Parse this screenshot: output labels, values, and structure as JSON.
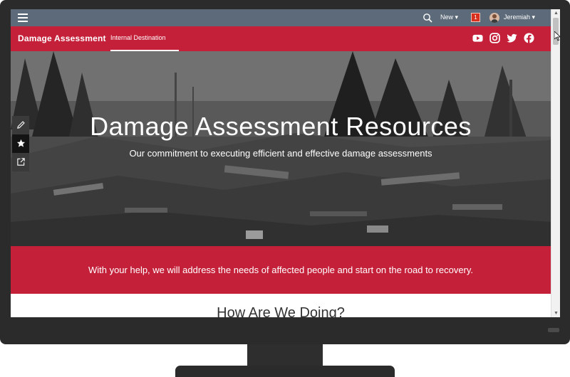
{
  "topbar": {
    "new_label": "New ▾",
    "notification_count": "1",
    "user_label": "Jeremiah ▾"
  },
  "nav": {
    "site_title": "Damage Assessment",
    "link_label": "Internal Destination",
    "social_icons": [
      "youtube-icon",
      "instagram-icon",
      "twitter-icon",
      "facebook-icon"
    ]
  },
  "hero": {
    "title": "Damage Assessment Resources",
    "subtitle": "Our commitment to executing efficient and effective damage assessments"
  },
  "side_tools": [
    "pencil-icon",
    "star-icon",
    "share-icon"
  ],
  "banner": {
    "text": "With your help, we will address the needs of affected people and start on the road to recovery."
  },
  "section": {
    "heading": "How Are We Doing?"
  },
  "colors": {
    "brand_red": "#c5203a",
    "topbar": "#5c6a79",
    "badge": "#d7301f",
    "bezel": "#2b2b2b"
  }
}
